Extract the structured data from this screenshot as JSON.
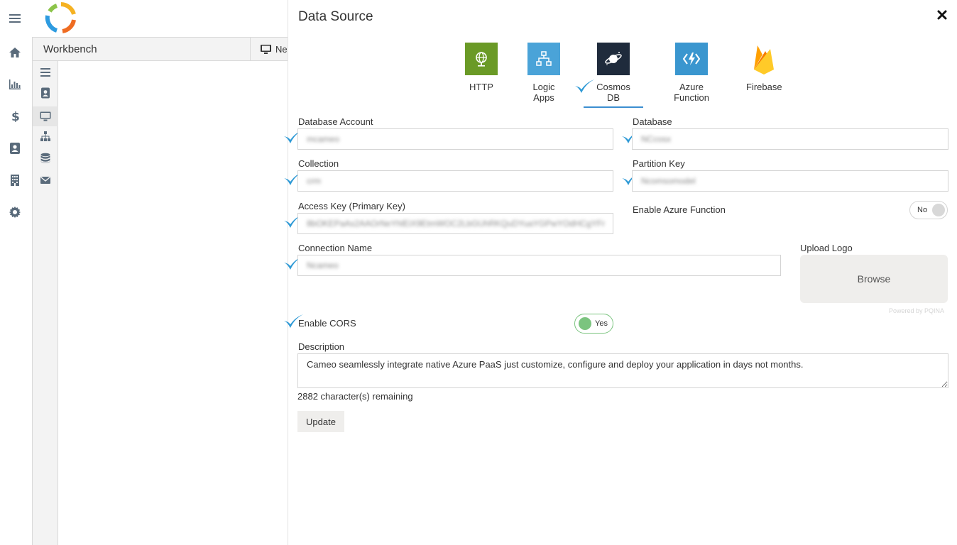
{
  "rail": {
    "icons": [
      "menu-icon",
      "home-icon",
      "bar-chart-icon",
      "dollar-icon",
      "contact-card-icon",
      "building-icon",
      "gear-icon"
    ]
  },
  "workbench": {
    "title": "Workbench",
    "new_label": "Ne"
  },
  "panel": {
    "title": "Data Source",
    "tabs": [
      {
        "label": "HTTP",
        "icon": "globe-icon",
        "color": "#6a9a26"
      },
      {
        "label": "Logic Apps",
        "icon": "sitemap-icon",
        "color": "#4aa3d8"
      },
      {
        "label": "Cosmos DB",
        "icon": "planet-icon",
        "color": "#1f2b3c",
        "active": true
      },
      {
        "label": "Azure Function",
        "icon": "lightning-icon",
        "color": "#3a96cf"
      },
      {
        "label": "Firebase",
        "icon": "firebase-flame-icon",
        "color": "#f8a825"
      }
    ],
    "fields": {
      "database_account": {
        "label": "Database Account",
        "value": "mcameo"
      },
      "database": {
        "label": "Database",
        "value": "NCcosx"
      },
      "collection": {
        "label": "Collection",
        "value": "crm"
      },
      "partition_key": {
        "label": "Partition Key",
        "value": "Ncomsomodel"
      },
      "access_key": {
        "label": "Access Key (Primary Key)",
        "value": "8bOKEPaAs2AAOrNeYhlEiX9EtmWOC2LbGUhRKQuDYuaYGPwYOdHCgYFr"
      },
      "connection_name": {
        "label": "Connection Name",
        "value": "Ncameo"
      }
    },
    "enable_azure_function": {
      "label": "Enable Azure Function",
      "state": "No"
    },
    "upload_logo": {
      "label": "Upload Logo",
      "button": "Browse",
      "powered_by": "Powered by PQINA"
    },
    "enable_cors": {
      "label": "Enable CORS",
      "state": "Yes"
    },
    "description": {
      "label": "Description",
      "value": "Cameo seamlessly integrate native Azure PaaS just customize, configure and deploy your application in days not months.",
      "remaining": "2882 character(s) remaining"
    },
    "update_label": "Update"
  },
  "colors": {
    "accent": "#3b8ed0",
    "check": "#2f9ad6",
    "toggle_on": "#7bc47f"
  }
}
